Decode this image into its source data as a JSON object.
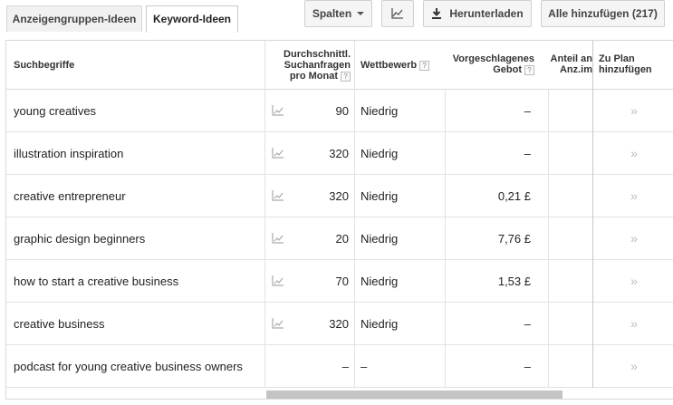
{
  "tabs": [
    {
      "label": "Anzeigengruppen-Ideen",
      "active": false
    },
    {
      "label": "Keyword-Ideen",
      "active": true
    }
  ],
  "toolbar": {
    "columns_label": "Spalten",
    "chart_icon": "line-chart-icon",
    "download_label": "Herunterladen",
    "download_icon": "download-icon",
    "add_all_label": "Alle hinzufügen (217)"
  },
  "table": {
    "headers": {
      "keyword": "Suchbegriffe",
      "avg_searches": [
        "Durchschnittl.",
        "Suchanfragen",
        "pro Monat"
      ],
      "competition": "Wettbewerb",
      "bid": [
        "Vorgeschlagenes",
        "Gebot"
      ],
      "share": [
        "Anteil an",
        "Anz.im"
      ],
      "add_to_plan": [
        "Zu Plan",
        "hinzufügen"
      ],
      "help_glyph": "?"
    },
    "rows": [
      {
        "keyword": "young creatives",
        "searches": "90",
        "competition": "Niedrig",
        "bid": "–",
        "trend": true
      },
      {
        "keyword": "illustration inspiration",
        "searches": "320",
        "competition": "Niedrig",
        "bid": "–",
        "trend": true
      },
      {
        "keyword": "creative entrepreneur",
        "searches": "320",
        "competition": "Niedrig",
        "bid": "0,21 £",
        "trend": true
      },
      {
        "keyword": "graphic design beginners",
        "searches": "20",
        "competition": "Niedrig",
        "bid": "7,76 £",
        "trend": true
      },
      {
        "keyword": "how to start a creative business",
        "searches": "70",
        "competition": "Niedrig",
        "bid": "1,53 £",
        "trend": true
      },
      {
        "keyword": "creative business",
        "searches": "320",
        "competition": "Niedrig",
        "bid": "–",
        "trend": true
      },
      {
        "keyword": "podcast for young creative business owners",
        "searches": "–",
        "competition": "–",
        "bid": "–",
        "trend": false
      }
    ],
    "add_glyph": "»"
  },
  "colors": {
    "border": "#d8d8d8",
    "row_line": "#e2e2e2",
    "scroll_thumb": "#c4c4c4",
    "chevron": "#bbbbbb"
  }
}
